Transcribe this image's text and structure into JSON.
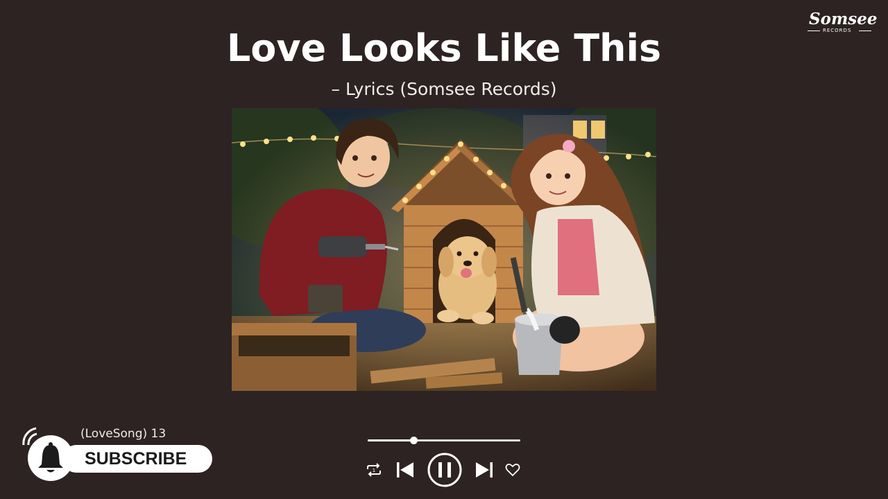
{
  "video": {
    "title": "Love Looks Like This",
    "subtitle": "– Lyrics (Somsee Records)"
  },
  "brand": {
    "name": "Somsee",
    "tagline": "RECORDS"
  },
  "channel": {
    "playlist_tag": "(LoveSong) 13",
    "subscribe_label": "SUBSCRIBE"
  },
  "player": {
    "progress": 0.3,
    "icons": [
      "repeat-icon",
      "previous-icon",
      "pause-icon",
      "next-icon",
      "heart-icon"
    ]
  },
  "colors": {
    "background": "#2c2322",
    "text": "#ffffff"
  }
}
